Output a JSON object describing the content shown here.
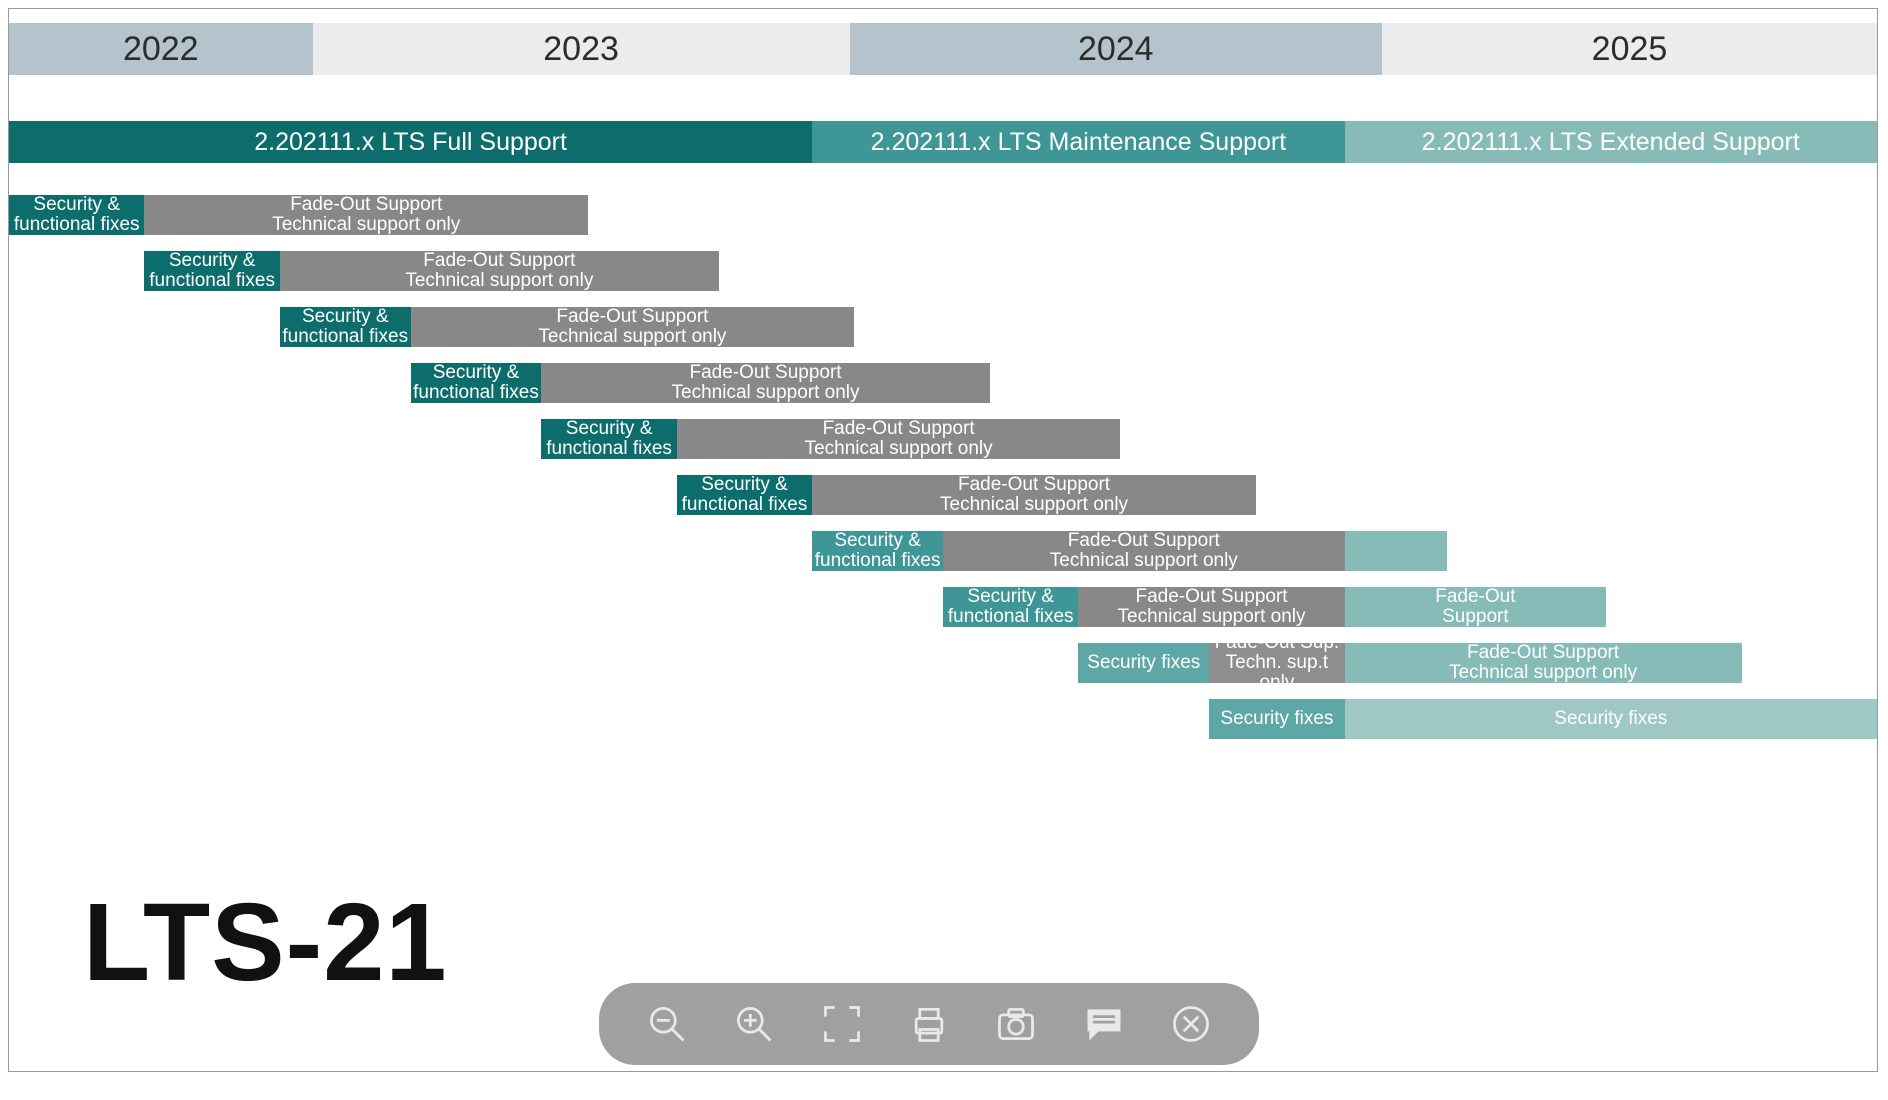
{
  "chart_data": {
    "type": "bar",
    "title": "LTS-21",
    "time_axis": {
      "start": 2022,
      "end": 2026
    },
    "years": [
      {
        "label": "2022",
        "start": 2022.0,
        "end": 2022.65,
        "style": "a"
      },
      {
        "label": "2023",
        "start": 2022.65,
        "end": 2023.8,
        "style": "b"
      },
      {
        "label": "2024",
        "start": 2023.8,
        "end": 2024.94,
        "style": "a"
      },
      {
        "label": "2025",
        "start": 2024.94,
        "end": 2026.0,
        "style": "b"
      }
    ],
    "lts_bars": [
      {
        "label": "2.202111.x LTS Full Support",
        "start": 2022.0,
        "end": 2023.72,
        "color": "dark"
      },
      {
        "label": "2.202111.x LTS Maintenance Support",
        "start": 2023.72,
        "end": 2024.86,
        "color": "mid"
      },
      {
        "label": "2.202111.x LTS Extended Support",
        "start": 2024.86,
        "end": 2026.0,
        "color": "light"
      }
    ],
    "rows": [
      {
        "index": 0,
        "segments": [
          {
            "label1": "Security &",
            "label2": "functional fixes",
            "start": 2022.0,
            "end": 2022.29,
            "color": "dark"
          },
          {
            "label1": "Fade-Out Support",
            "label2": "Technical support only",
            "start": 2022.29,
            "end": 2023.24,
            "color": "gray"
          }
        ]
      },
      {
        "index": 1,
        "segments": [
          {
            "label1": "Security &",
            "label2": "functional fixes",
            "start": 2022.29,
            "end": 2022.58,
            "color": "dark"
          },
          {
            "label1": "Fade-Out Support",
            "label2": "Technical support only",
            "start": 2022.58,
            "end": 2023.52,
            "color": "gray"
          }
        ]
      },
      {
        "index": 2,
        "segments": [
          {
            "label1": "Security &",
            "label2": "functional fixes",
            "start": 2022.58,
            "end": 2022.86,
            "color": "dark"
          },
          {
            "label1": "Fade-Out Support",
            "label2": "Technical support only",
            "start": 2022.86,
            "end": 2023.81,
            "color": "gray"
          }
        ]
      },
      {
        "index": 3,
        "segments": [
          {
            "label1": "Security &",
            "label2": "functional fixes",
            "start": 2022.86,
            "end": 2023.14,
            "color": "dark"
          },
          {
            "label1": "Fade-Out Support",
            "label2": "Technical support only",
            "start": 2023.14,
            "end": 2024.1,
            "color": "gray"
          }
        ]
      },
      {
        "index": 4,
        "segments": [
          {
            "label1": "Security &",
            "label2": "functional fixes",
            "start": 2023.14,
            "end": 2023.43,
            "color": "dark"
          },
          {
            "label1": "Fade-Out Support",
            "label2": "Technical support only",
            "start": 2023.43,
            "end": 2024.38,
            "color": "gray"
          }
        ]
      },
      {
        "index": 5,
        "segments": [
          {
            "label1": "Security &",
            "label2": "functional fixes",
            "start": 2023.43,
            "end": 2023.72,
            "color": "dark"
          },
          {
            "label1": "Fade-Out Support",
            "label2": "Technical support only",
            "start": 2023.72,
            "end": 2024.67,
            "color": "gray"
          }
        ]
      },
      {
        "index": 6,
        "segments": [
          {
            "label1": "Security &",
            "label2": "functional fixes",
            "start": 2023.72,
            "end": 2024.0,
            "color": "mid"
          },
          {
            "label1": "Fade-Out Support",
            "label2": "Technical support only",
            "start": 2024.0,
            "end": 2024.86,
            "color": "gray"
          },
          {
            "label1": "",
            "label2": "",
            "start": 2024.86,
            "end": 2025.08,
            "color": "light"
          }
        ]
      },
      {
        "index": 7,
        "segments": [
          {
            "label1": "Security &",
            "label2": "functional fixes",
            "start": 2024.0,
            "end": 2024.29,
            "color": "mid"
          },
          {
            "label1": "Fade-Out Support",
            "label2": "Technical support only",
            "start": 2024.29,
            "end": 2024.86,
            "color": "gray"
          },
          {
            "label1": "Fade-Out",
            "label2": "Support",
            "start": 2024.86,
            "end": 2025.42,
            "color": "light"
          }
        ]
      },
      {
        "index": 8,
        "segments": [
          {
            "label1": "Security fixes",
            "label2": "",
            "start": 2024.29,
            "end": 2024.57,
            "color": "mid2"
          },
          {
            "label1": "Fade-Out Sup.",
            "label2": "Techn. sup.t only",
            "start": 2024.57,
            "end": 2024.86,
            "color": "gray2"
          },
          {
            "label1": "Fade-Out Support",
            "label2": "Technical support only",
            "start": 2024.86,
            "end": 2025.71,
            "color": "light"
          }
        ]
      },
      {
        "index": 9,
        "segments": [
          {
            "label1": "Security fixes",
            "label2": "",
            "start": 2024.57,
            "end": 2024.86,
            "color": "mid2"
          },
          {
            "label1": "Security fixes",
            "label2": "",
            "start": 2024.86,
            "end": 2026.0,
            "color": "light2"
          }
        ]
      }
    ]
  },
  "title": "LTS-21",
  "toolbar": {
    "zoom_out": "Zoom out",
    "zoom_in": "Zoom in",
    "fit": "Fit to screen",
    "print": "Print",
    "screenshot": "Screenshot",
    "comment": "Comment",
    "close": "Close"
  }
}
